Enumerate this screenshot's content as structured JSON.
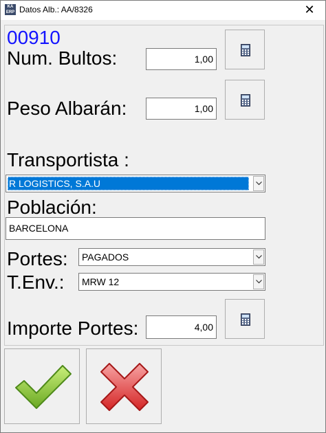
{
  "window": {
    "title": "Datos Alb.: AA/8326",
    "icon_text": "KA ERP",
    "close_glyph": "✕"
  },
  "form": {
    "code": "00910",
    "bultos": {
      "label": "Num. Bultos:",
      "value": "1,00"
    },
    "peso": {
      "label": "Peso Albarán:",
      "value": "1,00"
    },
    "transportista": {
      "label": "Transportista :",
      "value": "R LOGISTICS, S.A.U"
    },
    "poblacion": {
      "label": "Población:",
      "value": "BARCELONA"
    },
    "portes": {
      "label": "Portes:",
      "value": "PAGADOS"
    },
    "tenv": {
      "label": "T.Env.:",
      "value": "MRW 12"
    },
    "importe": {
      "label": "Importe Portes:",
      "value": "4,00"
    }
  },
  "icons": {
    "calculator": "calculator-icon",
    "ok": "checkmark-icon",
    "cancel": "cross-icon",
    "dropdown": "chevron-down-icon"
  },
  "colors": {
    "code": "#1414ff",
    "selection": "#0078d7",
    "ok": "#8cc63f",
    "cancel": "#e03a3a"
  }
}
